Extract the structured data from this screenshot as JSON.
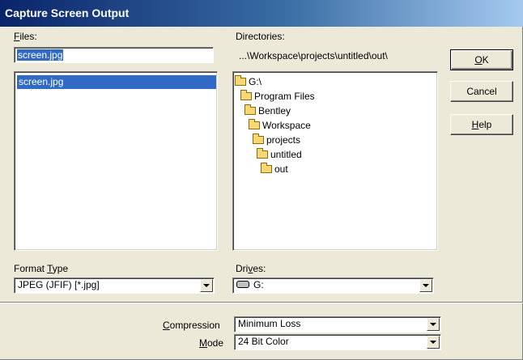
{
  "window": {
    "title": "Capture Screen Output"
  },
  "files": {
    "label_pre": "",
    "label_u": "F",
    "label_post": "iles:",
    "input_value": "screen.jpg",
    "items": [
      "screen.jpg"
    ]
  },
  "directories": {
    "label": "Directories:",
    "current_path": "...\\Workspace\\projects\\untitled\\out\\",
    "tree": [
      "G:\\",
      "Program Files",
      "Bentley",
      "Workspace",
      "projects",
      "untitled",
      "out"
    ]
  },
  "buttons": {
    "ok_u": "O",
    "ok_post": "K",
    "cancel": "Cancel",
    "help_u": "H",
    "help_post": "elp"
  },
  "format": {
    "label_pre": "Format ",
    "label_u": "T",
    "label_post": "ype",
    "value": "JPEG (JFIF) [*.jpg]"
  },
  "drives": {
    "label_pre": "Dri",
    "label_u": "v",
    "label_post": "es:",
    "value": "G:"
  },
  "compression": {
    "label_u": "C",
    "label_post": "ompression",
    "value": "Minimum Loss"
  },
  "mode": {
    "label_u": "M",
    "label_post": "ode",
    "value": "24 Bit Color"
  },
  "icons": {
    "folder": "folder-open-icon",
    "drive": "drive-icon",
    "dropdown": "chevron-down-icon"
  },
  "colors": {
    "title_start": "#0a246a",
    "title_end": "#a6caf0",
    "selection": "#316ac5",
    "face": "#ece9d8"
  }
}
